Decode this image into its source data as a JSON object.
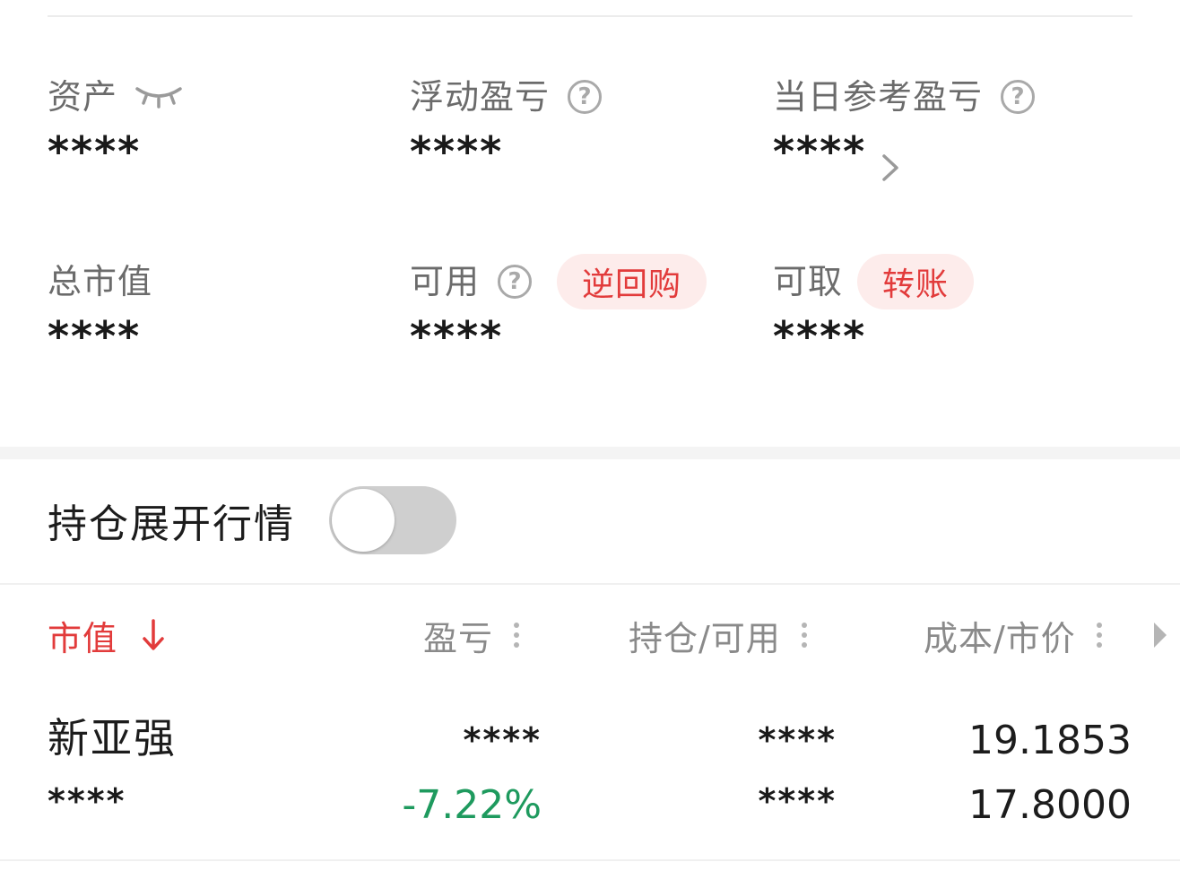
{
  "assets": {
    "total_assets": {
      "label": "资产",
      "value": "****",
      "eye_icon": "eye-closed-icon"
    },
    "floating_pnl": {
      "label": "浮动盈亏",
      "value": "****",
      "help_icon": "question-icon",
      "help_glyph": "?"
    },
    "daily_pnl": {
      "label": "当日参考盈亏",
      "value": "****",
      "help_icon": "question-icon",
      "help_glyph": "?",
      "more_icon": "chevron-right-icon"
    },
    "market_value": {
      "label": "总市值",
      "value": "****"
    },
    "available": {
      "label": "可用",
      "value": "****",
      "help_icon": "question-icon",
      "help_glyph": "?",
      "action": "逆回购"
    },
    "withdrawable": {
      "label": "可取",
      "value": "****",
      "action": "转账"
    }
  },
  "position_toggle": {
    "label": "持仓展开行情",
    "enabled": false
  },
  "table": {
    "headers": {
      "market_value": "市值",
      "pnl": "盈亏",
      "position": "持仓/可用",
      "cost_price": "成本/市价"
    },
    "rows": [
      {
        "name": "新亚强",
        "market_value": "****",
        "pnl": "****",
        "pnl_pct": "-7.22%",
        "position": "****",
        "available": "****",
        "cost": "19.1853",
        "price": "17.8000"
      }
    ]
  },
  "colors": {
    "accent_red": "#e23b3b",
    "pill_bg": "#fdeceb",
    "loss_green": "#1e9a5e",
    "label_gray": "#6b6b6b"
  }
}
